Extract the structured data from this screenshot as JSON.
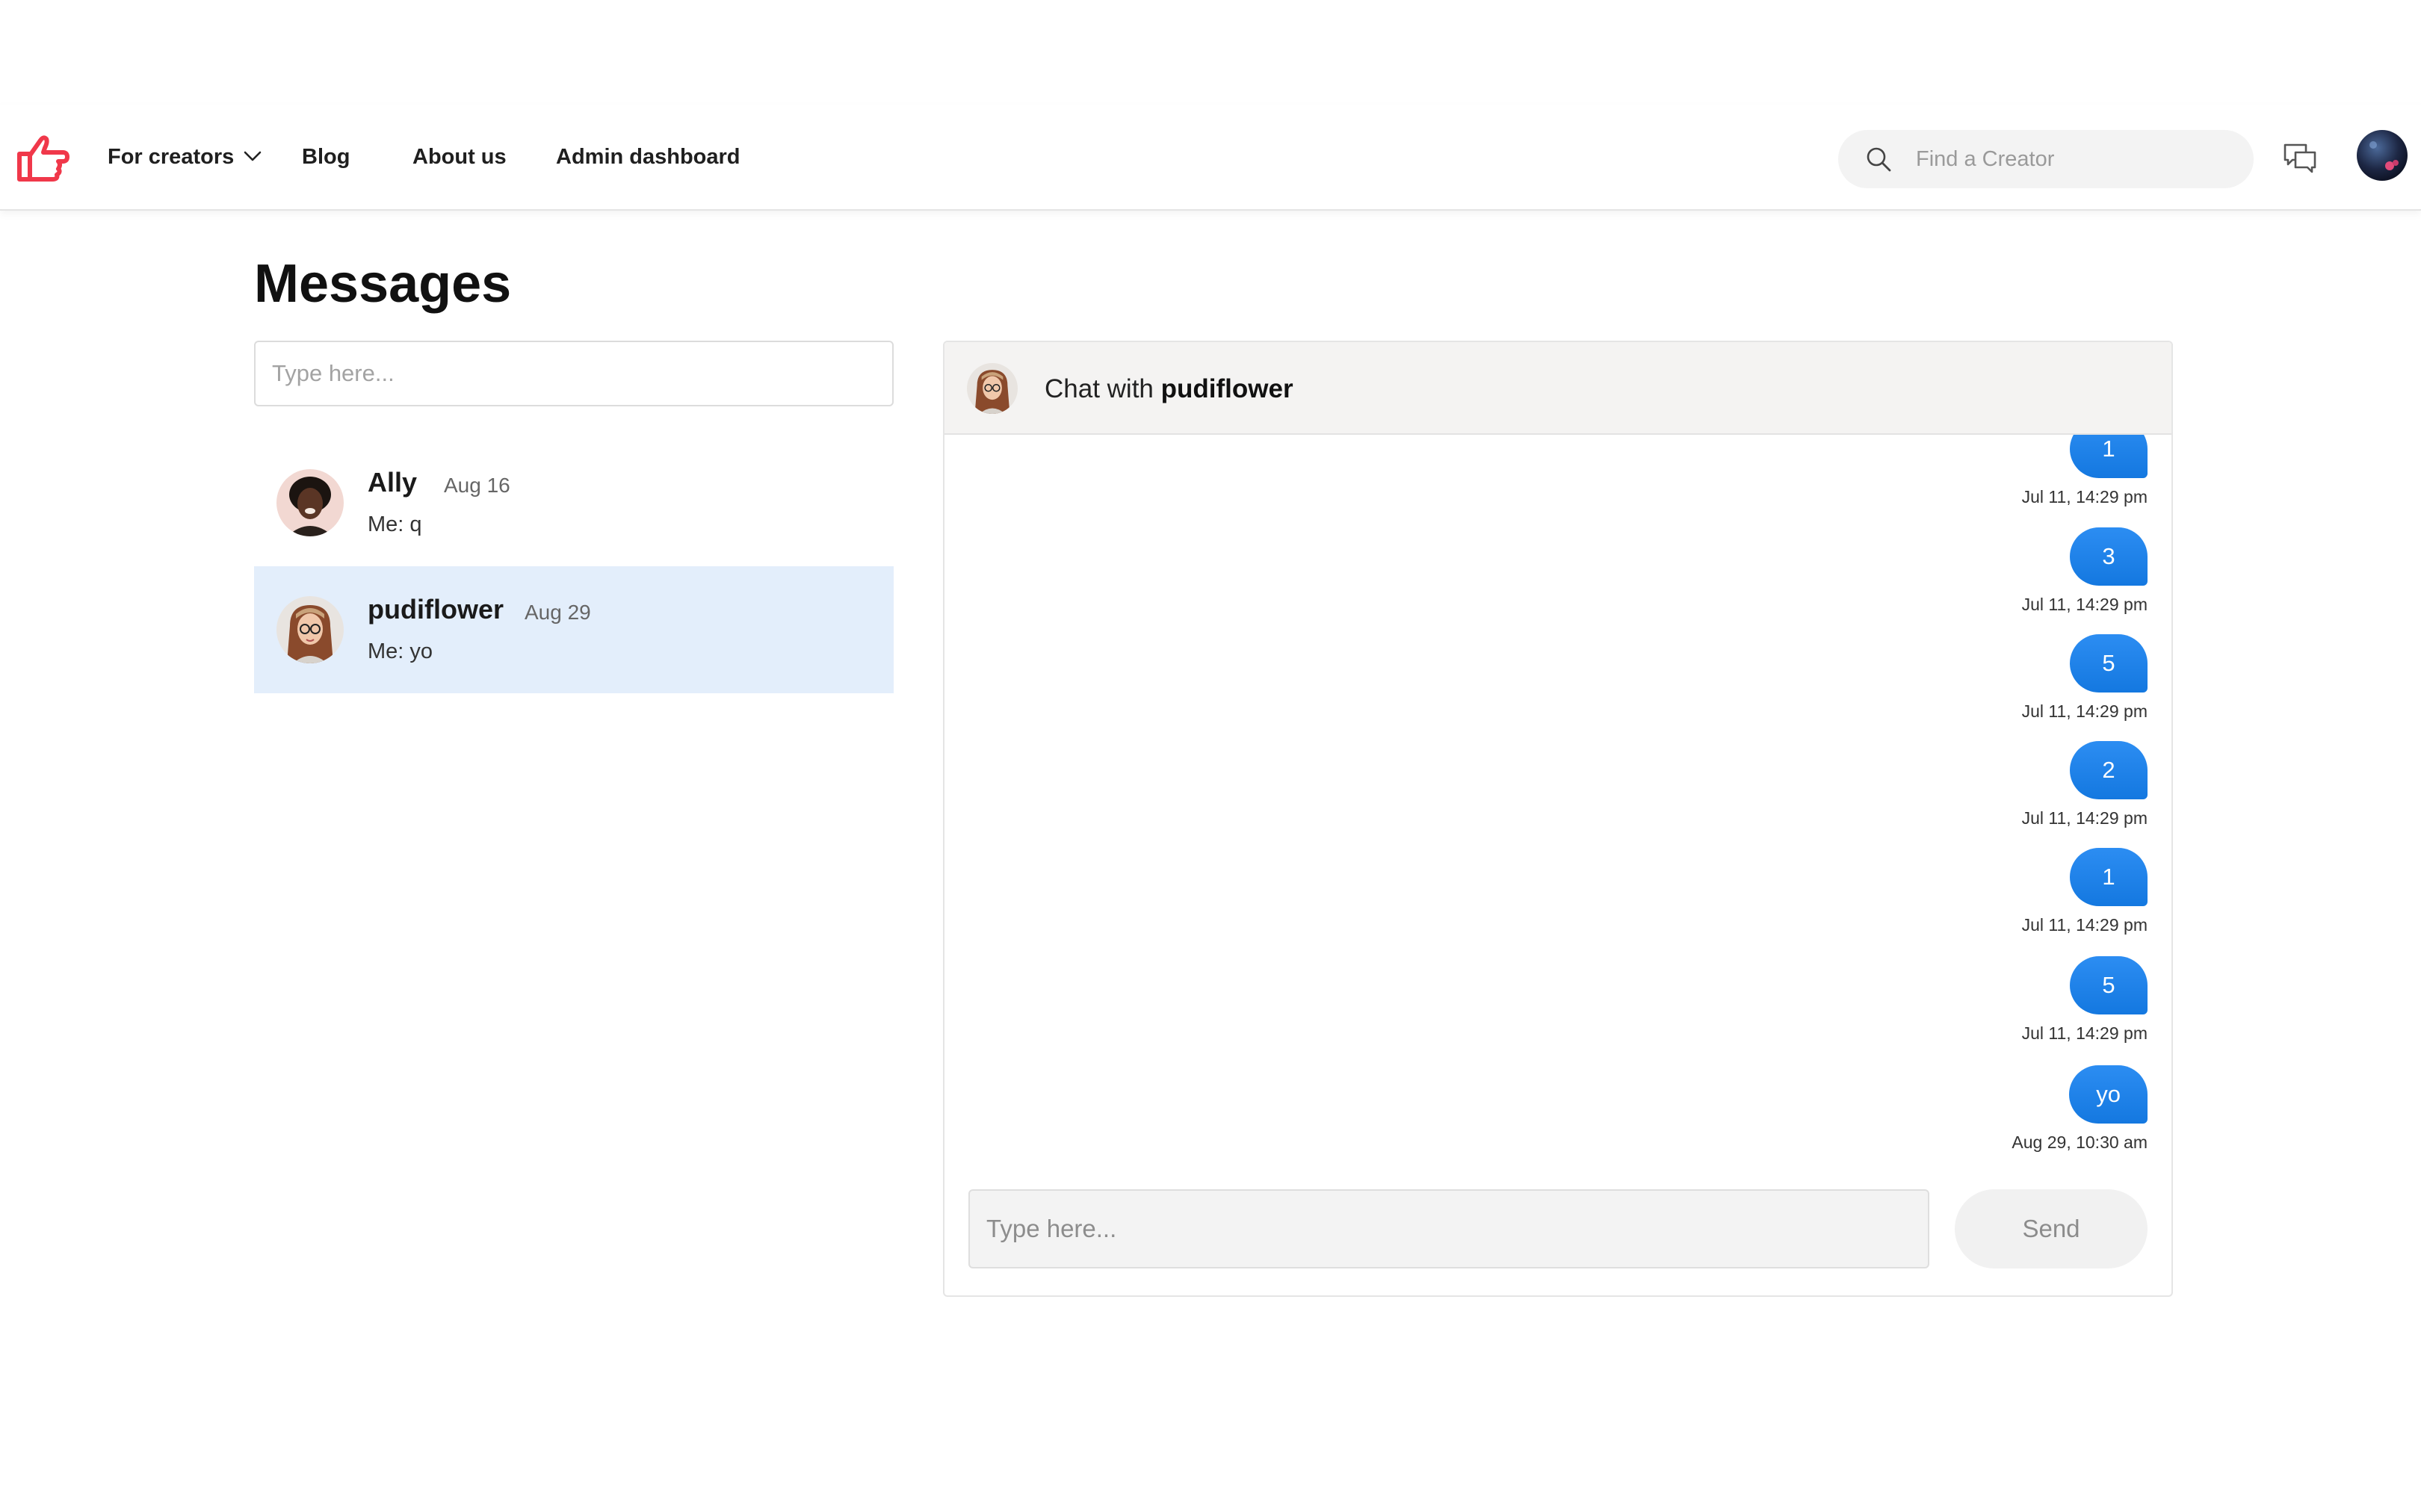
{
  "header": {
    "nav": [
      {
        "label": "For creators",
        "has_dropdown": true
      },
      {
        "label": "Blog"
      },
      {
        "label": "About us"
      },
      {
        "label": "Admin dashboard"
      }
    ],
    "search_placeholder": "Find a Creator",
    "colors": {
      "logo": "#f0384a",
      "accent": "#2184ec"
    }
  },
  "page": {
    "title": "Messages",
    "conversation_search_placeholder": "Type here..."
  },
  "conversations": [
    {
      "name": "Ally",
      "date": "Aug 16",
      "preview": "Me: q",
      "active": false
    },
    {
      "name": "pudiflower",
      "date": "Aug 29",
      "preview": "Me: yo",
      "active": true
    }
  ],
  "chat": {
    "title_prefix": "Chat with",
    "partner": "pudiflower",
    "messages": [
      {
        "text": "1",
        "time": "Jul 11, 14:29 pm"
      },
      {
        "text": "3",
        "time": "Jul 11, 14:29 pm"
      },
      {
        "text": "5",
        "time": "Jul 11, 14:29 pm"
      },
      {
        "text": "2",
        "time": "Jul 11, 14:29 pm"
      },
      {
        "text": "1",
        "time": "Jul 11, 14:29 pm"
      },
      {
        "text": "5",
        "time": "Jul 11, 14:29 pm"
      },
      {
        "text": "yo",
        "time": "Aug 29, 10:30 am"
      }
    ],
    "composer_placeholder": "Type here...",
    "send_label": "Send"
  }
}
